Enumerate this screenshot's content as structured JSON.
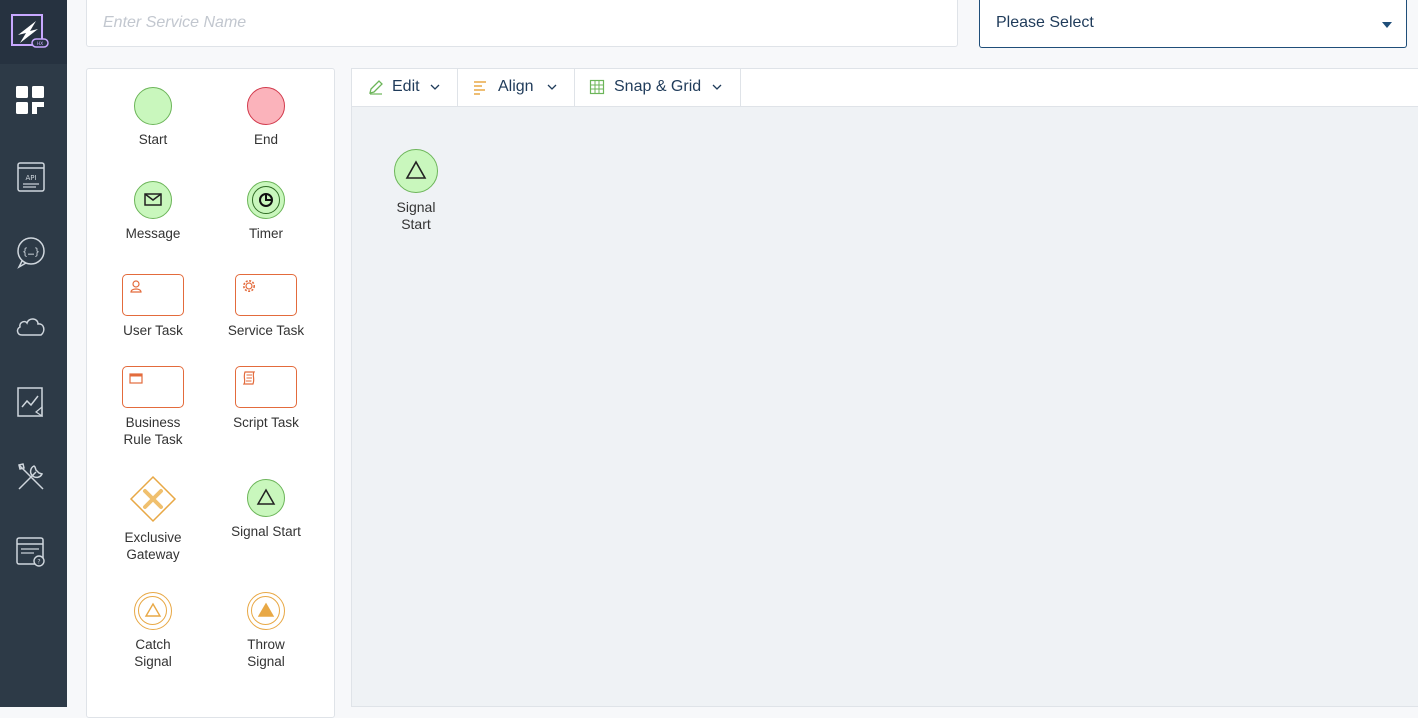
{
  "header": {
    "service_placeholder": "Enter Service Name",
    "select_value": "Please Select"
  },
  "rail": {
    "items": [
      "dashboard-icon",
      "api-icon",
      "chat-code-icon",
      "cloud-icon",
      "analytics-icon",
      "tools-icon",
      "settings-form-icon"
    ]
  },
  "palette": {
    "items": [
      {
        "label": "Start"
      },
      {
        "label": "End"
      },
      {
        "label": "Message"
      },
      {
        "label": "Timer"
      },
      {
        "label": "User Task"
      },
      {
        "label": "Service Task"
      },
      {
        "label": "Business Rule Task"
      },
      {
        "label": "Script Task"
      },
      {
        "label": "Exclusive Gateway"
      },
      {
        "label": "Signal Start"
      },
      {
        "label": "Catch Signal"
      },
      {
        "label": "Throw Signal"
      }
    ]
  },
  "toolbar": {
    "edit_label": "Edit",
    "align_label": "Align",
    "snap_label": "Snap & Grid"
  },
  "canvas": {
    "node_label": "Signal Start"
  },
  "colors": {
    "rail_bg": "#2d3a47",
    "start_fill": "#c9f7bd",
    "end_fill": "#fbb3bb",
    "task_stroke": "#e36b3c",
    "gateway_stroke": "#e8a845",
    "canvas_bg": "#eff2f5",
    "text_blue": "#1f3b5a"
  }
}
